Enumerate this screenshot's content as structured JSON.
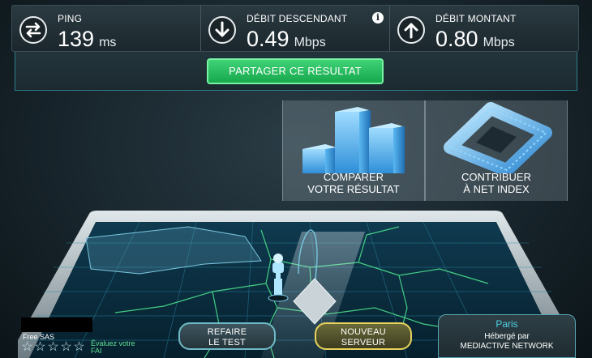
{
  "metrics": {
    "ping": {
      "label": "PING",
      "value": "139",
      "unit": "ms",
      "icon": "swap-arrows-icon"
    },
    "download": {
      "label": "DÉBIT DESCENDANT",
      "value": "0.49",
      "unit": "Mbps",
      "icon": "arrow-down-icon",
      "info_icon": "i"
    },
    "upload": {
      "label": "DÉBIT MONTANT",
      "value": "0.80",
      "unit": "Mbps",
      "icon": "arrow-up-icon"
    }
  },
  "share": {
    "label": "PARTAGER CE RÉSULTAT"
  },
  "panels": {
    "compare": {
      "line1": "COMPARER",
      "line2": "VOTRE RÉSULTAT",
      "icon": "bar-chart-icon"
    },
    "contribute": {
      "line1": "CONTRIBUER",
      "line2": "À NET INDEX",
      "icon": "net-index-logo-icon"
    }
  },
  "isp": {
    "name": "Free SAS",
    "rating": 0,
    "rating_max": 5,
    "rate_text_1": "Évaluez votre",
    "rate_text_2": "FAI"
  },
  "buttons": {
    "retest_line1": "REFAIRE",
    "retest_line2": "LE TEST",
    "new_server_line1": "NOUVEAU",
    "new_server_line2": "SERVEUR"
  },
  "server": {
    "city": "Paris",
    "hosted_line1": "Hébergé par",
    "hosted_line2": "MEDIACTIVE NETWORK"
  },
  "colors": {
    "accent_green": "#2ecc6a",
    "accent_cyan": "#4fd0e6",
    "accent_yellow": "#e6d25c"
  }
}
